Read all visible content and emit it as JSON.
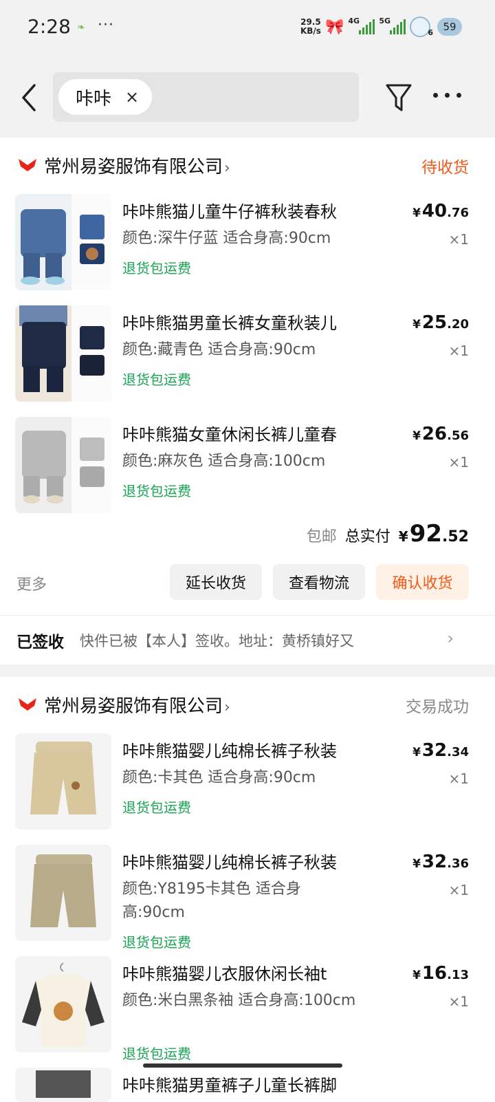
{
  "status_bar": {
    "time": "2:28",
    "dots": "···",
    "net_speed_value": "29.5",
    "net_speed_unit": "KB/s",
    "signal1_label": "4G",
    "signal2_label": "5G",
    "notif_count": "6",
    "battery": "59"
  },
  "nav": {
    "search_chip": "咔咔",
    "chip_close": "×"
  },
  "orders": [
    {
      "store": "常州易姿服饰有限公司",
      "status": "待收货",
      "status_color": "#f25a1b",
      "items": [
        {
          "title": "咔咔熊猫儿童牛仔裤秋装春秋",
          "spec": "颜色:深牛仔蓝 适合身高:90cm",
          "tag": "退货包运费",
          "price_int": "40",
          "price_dec": ".76",
          "qty": "×1"
        },
        {
          "title": "咔咔熊猫男童长裤女童秋装儿",
          "spec": "颜色:藏青色 适合身高:90cm",
          "tag": "退货包运费",
          "price_int": "25",
          "price_dec": ".20",
          "qty": "×1"
        },
        {
          "title": "咔咔熊猫女童休闲长裤儿童春",
          "spec": "颜色:麻灰色 适合身高:100cm",
          "tag": "退货包运费",
          "price_int": "26",
          "price_dec": ".56",
          "qty": "×1"
        }
      ],
      "total": {
        "shipping": "包邮",
        "label": "总实付",
        "amount_int": "92",
        "amount_dec": ".52"
      },
      "more": "更多",
      "buttons": {
        "extend": "延长收货",
        "logistics": "查看物流",
        "confirm": "确认收货"
      },
      "logistics": {
        "status": "已签收",
        "detail": "快件已被【本人】签收。地址：黄桥镇好又"
      }
    },
    {
      "store": "常州易姿服饰有限公司",
      "status": "交易成功",
      "status_color": "#888888",
      "items": [
        {
          "title": "咔咔熊猫婴儿纯棉长裤子秋装",
          "spec": "颜色:卡其色 适合身高:90cm",
          "tag": "退货包运费",
          "price_int": "32",
          "price_dec": ".34",
          "qty": "×1"
        },
        {
          "title": "咔咔熊猫婴儿纯棉长裤子秋装",
          "spec": "颜色:Y8195卡其色 适合身高:90cm",
          "tag": "退货包运费",
          "price_int": "32",
          "price_dec": ".36",
          "qty": "×1"
        },
        {
          "title": "咔咔熊猫婴儿衣服休闲长袖t",
          "spec": "颜色:米白黑条袖 适合身高:100cm",
          "tag": "退货包运费",
          "price_int": "16",
          "price_dec": ".13",
          "qty": "×1"
        },
        {
          "title": "咔咔熊猫男童裤子儿童长裤脚"
        }
      ]
    }
  ],
  "currency": "¥",
  "colors": {
    "accent": "#f25a1b",
    "tag_green": "#1aa355",
    "store_red": "#e8241a"
  }
}
